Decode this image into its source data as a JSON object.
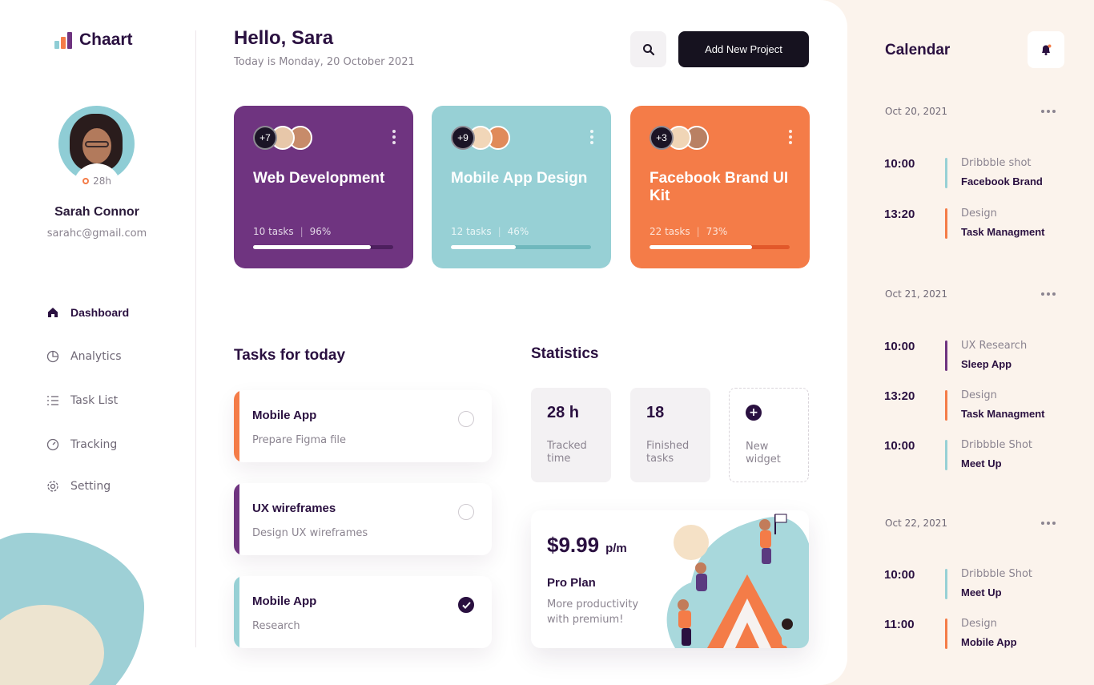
{
  "app": {
    "name": "Chaart",
    "logo_colors": [
      "#8fcdd5",
      "#f47c48",
      "#6f3480"
    ]
  },
  "user": {
    "name": "Sarah Connor",
    "email": "sarahc@gmail.com",
    "hours_badge": "28h"
  },
  "sidebar": {
    "items": [
      {
        "label": "Dashboard",
        "icon": "home-icon",
        "active": true
      },
      {
        "label": "Analytics",
        "icon": "pie-chart-icon",
        "active": false
      },
      {
        "label": "Task List",
        "icon": "list-icon",
        "active": false
      },
      {
        "label": "Tracking",
        "icon": "gauge-icon",
        "active": false
      },
      {
        "label": "Setting",
        "icon": "gear-icon",
        "active": false
      }
    ]
  },
  "header": {
    "greeting": "Hello, Sara",
    "date": "Today is Monday, 20 October 2021",
    "add_button": "Add New Project"
  },
  "projects": [
    {
      "title": "Web Development",
      "extra_members": "+7",
      "tasks": "10 tasks",
      "percent": "96%",
      "progress": 0.84,
      "color": "#6f3480",
      "track": "#4d1f5e"
    },
    {
      "title": "Mobile App Design",
      "extra_members": "+9",
      "tasks": "12 tasks",
      "percent": "46%",
      "progress": 0.46,
      "color": "#97d0d5",
      "track": "#6fb8bd"
    },
    {
      "title": "Facebook Brand UI Kit",
      "extra_members": "+3",
      "tasks": "22 tasks",
      "percent": "73%",
      "progress": 0.73,
      "color": "#f47c48",
      "track": "#e2582a"
    }
  ],
  "tasks": {
    "title": "Tasks for today",
    "items": [
      {
        "title": "Mobile App",
        "subtitle": "Prepare Figma file",
        "done": false,
        "accent": "#f47c48"
      },
      {
        "title": "UX wireframes",
        "subtitle": "Design UX wireframes",
        "done": false,
        "accent": "#6f3480"
      },
      {
        "title": "Mobile App",
        "subtitle": "Research",
        "done": true,
        "accent": "#97d0d5"
      }
    ]
  },
  "statistics": {
    "title": "Statistics",
    "tracked": {
      "value": "28 h",
      "label": "Tracked time"
    },
    "finished": {
      "value": "18",
      "label": "Finished tasks"
    },
    "new_widget": {
      "label": "New widget"
    }
  },
  "pro_plan": {
    "price": "$9.99",
    "period": "p/m",
    "name": "Pro Plan",
    "description": "More productivity with premium!"
  },
  "calendar": {
    "title": "Calendar",
    "days": [
      {
        "date": "Oct 20, 2021",
        "events": [
          {
            "time": "10:00",
            "category": "Dribbble shot",
            "name": "Facebook Brand",
            "color": "#97d0d5"
          },
          {
            "time": "13:20",
            "category": "Design",
            "name": "Task Managment",
            "color": "#f47c48"
          }
        ]
      },
      {
        "date": "Oct 21, 2021",
        "events": [
          {
            "time": "10:00",
            "category": "UX Research",
            "name": "Sleep App",
            "color": "#6f3480"
          },
          {
            "time": "13:20",
            "category": "Design",
            "name": "Task Managment",
            "color": "#f47c48"
          },
          {
            "time": "10:00",
            "category": "Dribbble Shot",
            "name": "Meet Up",
            "color": "#97d0d5"
          }
        ]
      },
      {
        "date": "Oct 22, 2021",
        "events": [
          {
            "time": "10:00",
            "category": "Dribbble Shot",
            "name": "Meet Up",
            "color": "#97d0d5"
          },
          {
            "time": "11:00",
            "category": "Design",
            "name": "Mobile App",
            "color": "#f47c48"
          }
        ]
      }
    ]
  }
}
